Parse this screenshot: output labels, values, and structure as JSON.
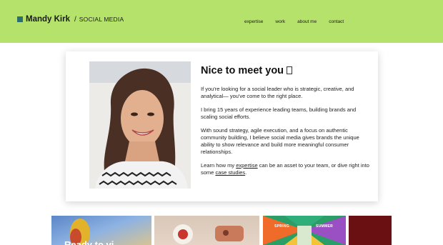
{
  "header": {
    "brand_name": "Mandy Kirk",
    "brand_sep": "/",
    "brand_sub": "SOCIAL MEDIA",
    "nav": [
      "expertise",
      "work",
      "about me",
      "contact"
    ]
  },
  "intro": {
    "title": "Nice to meet you",
    "p1": "If you're looking for a social leader who is strategic, creative, and analytical— you've come to the right place.",
    "p2": "I bring 15 years of experience leading teams, building brands and scaling social efforts.",
    "p3": "With sound strategy, agile execution, and a focus on authentic community building, I believe social media gives brands the unique ability to show relevance and build more meaningful consumer relationships.",
    "p4_a": "Learn how my ",
    "p4_link1": "expertise",
    "p4_b": " can be an asset to your team, or dive right into some ",
    "p4_link2": "case studies",
    "p4_c": "."
  },
  "tiles": {
    "t1_text": "Ready to vi",
    "t3_labels": [
      "SPRING",
      "SUMMER"
    ]
  },
  "colors": {
    "header_bg": "#b5e26a",
    "brand_square": "#2e6f6b"
  }
}
